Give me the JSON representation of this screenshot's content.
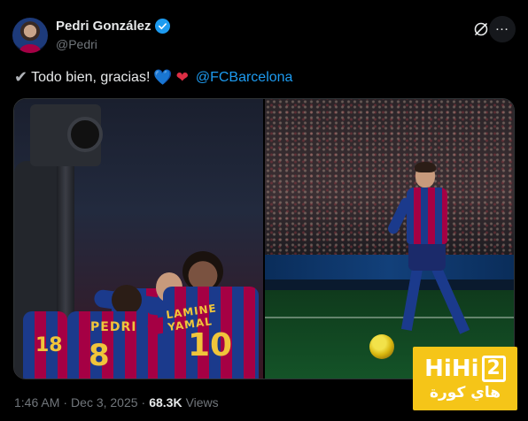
{
  "author": {
    "display_name": "Pedri González",
    "handle": "@Pedri"
  },
  "icons": {
    "verified": "verified-badge-icon",
    "grok": "grok-icon",
    "more": "more-options-icon"
  },
  "tweet": {
    "check_emoji": "✔",
    "text": "Todo bien, gracias!",
    "heart_blue": "💙",
    "heart_red": "❤",
    "mention": "@FCBarcelona"
  },
  "media": {
    "left_photo": {
      "jersey_names": [
        "PEDRI",
        "LAMINE YAMAL"
      ],
      "jersey_numbers": [
        "8",
        "10",
        "18"
      ]
    },
    "right_photo": {}
  },
  "meta": {
    "time": "1:46 AM",
    "separator": "·",
    "date": "Dec 3, 2025",
    "views_count": "68.3K",
    "views_label": "Views"
  },
  "watermark": {
    "brand_main": "HiHi",
    "brand_num": "2",
    "brand_arabic": "هاي كورة"
  },
  "colors": {
    "background": "#000000",
    "text": "#e7e9ea",
    "secondary": "#71767b",
    "link": "#1d9bf0",
    "watermark": "#f5c518"
  }
}
